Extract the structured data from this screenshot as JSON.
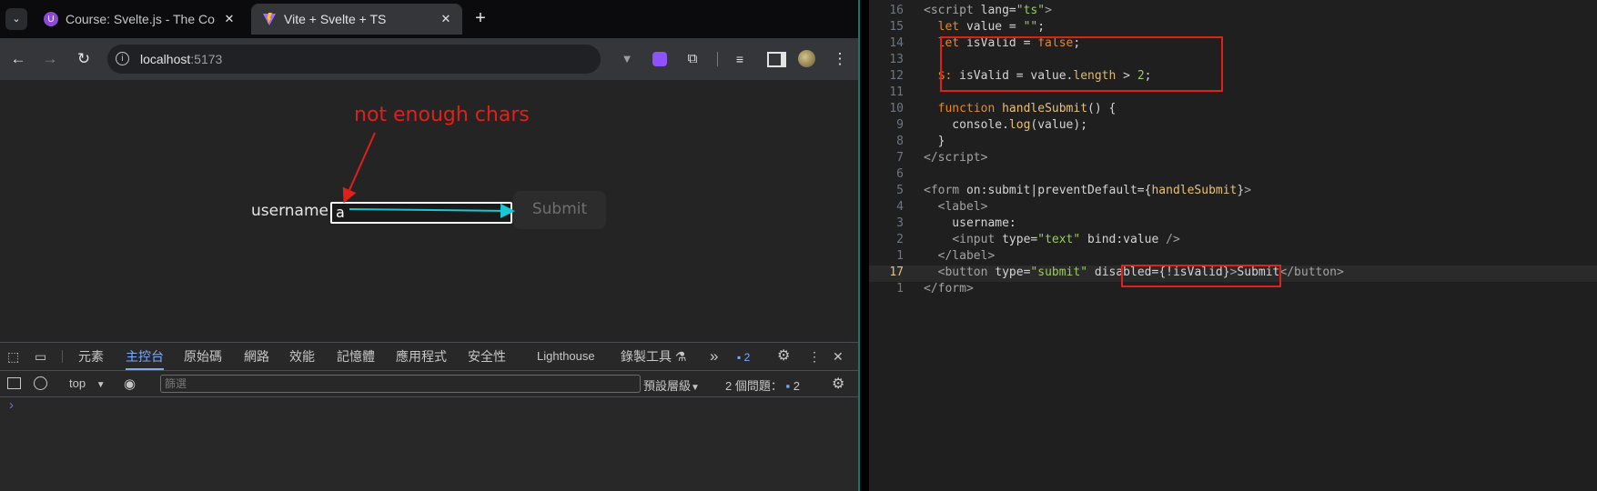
{
  "browser": {
    "tabs": [
      {
        "title": "Course: Svelte.js - The Co",
        "active": false,
        "close": "✕"
      },
      {
        "title": "Vite + Svelte + TS",
        "active": true,
        "close": "✕"
      }
    ],
    "new_tab": "+",
    "url_host": "localhost",
    "url_port": ":5173",
    "page": {
      "annotation": "not enough chars",
      "label": "username:",
      "input_value": "a",
      "submit_label": "Submit"
    }
  },
  "devtools": {
    "tabs": [
      "元素",
      "主控台",
      "原始碼",
      "網路",
      "效能",
      "記憶體",
      "應用程式",
      "安全性",
      "Lighthouse",
      "錄製工具 ⚗"
    ],
    "active_tab": "主控台",
    "more": "»",
    "issue_count": "2",
    "context": "top",
    "filter_placeholder": "篩選",
    "levels": "預設層級",
    "issues_label": "2 個問題：",
    "issues_count": "2",
    "prompt": "›"
  },
  "editor": {
    "line_numbers": [
      "16",
      "15",
      "14",
      "13",
      "12",
      "11",
      "10",
      "9",
      "8",
      "7",
      "6",
      "5",
      "4",
      "3",
      "2",
      "1",
      "17",
      "1"
    ],
    "current_line_index": 16
  },
  "colors": {
    "annotation_red": "#e0201a",
    "arrow_cyan": "#19c6d6",
    "string_green": "#9acb5e",
    "keyword_orange": "#e28a2d"
  }
}
